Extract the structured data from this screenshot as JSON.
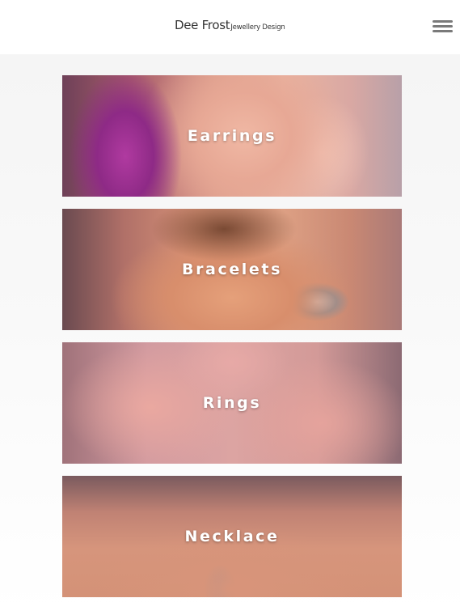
{
  "header": {
    "brand_name": "Dee Frost",
    "brand_tagline": "Jewellery Design",
    "menu_icon": "hamburger-menu-icon",
    "menu_icon_color": "#7a7a7a"
  },
  "categories": [
    {
      "label": "Earrings"
    },
    {
      "label": "Bracelets"
    },
    {
      "label": "Rings"
    },
    {
      "label": "Necklace"
    }
  ]
}
